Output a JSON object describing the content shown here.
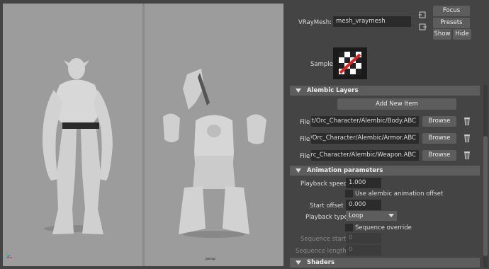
{
  "viewport": {
    "camera_label": "persp"
  },
  "vraymesh": {
    "label": "VRayMesh:",
    "value": "mesh_vraymesh"
  },
  "buttons": {
    "focus": "Focus",
    "presets": "Presets",
    "show": "Show",
    "hide": "Hide"
  },
  "sample": {
    "label": "Sample"
  },
  "alembic": {
    "header": "Alembic Layers",
    "add_item": "Add New Item",
    "items": [
      {
        "label": "File",
        "path": "ject/Orc_Character/Alembic/Body.ABC",
        "browse": "Browse"
      },
      {
        "label": "File",
        "path": "ect/Orc_Character/Alembic/Armor.ABC",
        "browse": "Browse"
      },
      {
        "label": "File",
        "path": "t/Orc_Character/Alembic/Weapon.ABC",
        "browse": "Browse"
      }
    ]
  },
  "animation": {
    "header": "Animation parameters",
    "playback_speed_label": "Playback speed",
    "playback_speed_value": "1.000",
    "use_alembic_offset_label": "Use alembic animation offset",
    "start_offset_label": "Start offset",
    "start_offset_value": "0.000",
    "playback_type_label": "Playback type",
    "playback_type_value": "Loop",
    "sequence_override_label": "Sequence override",
    "sequence_start_label": "Sequence start",
    "sequence_start_value": "0",
    "sequence_length_label": "Sequence length",
    "sequence_length_value": "0"
  },
  "shaders": {
    "header": "Shaders"
  },
  "colors": {
    "viewport_bg": "#9c9c9c",
    "panel_bg": "#444444",
    "field_bg": "#2b2b2b",
    "button_bg": "#5d5d5d"
  }
}
